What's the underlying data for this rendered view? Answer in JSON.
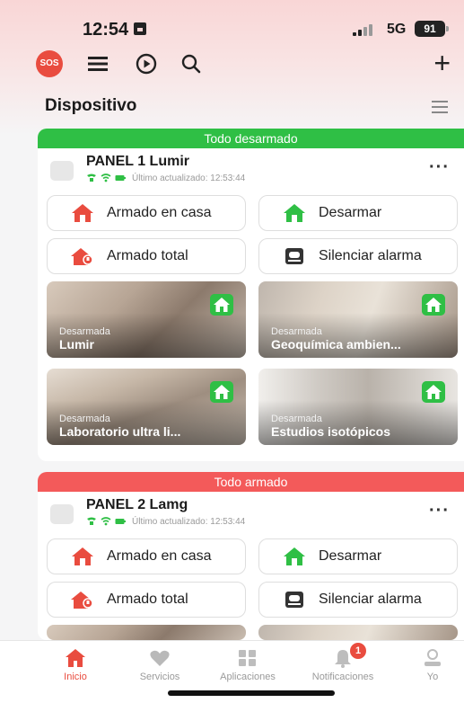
{
  "status_bar": {
    "time": "12:54",
    "network": "5G",
    "battery": "91"
  },
  "toolbar": {
    "sos_label": "SOS",
    "plus_label": "+"
  },
  "section": {
    "title": "Dispositivo"
  },
  "panels": [
    {
      "banner": "Todo desarmado",
      "banner_color": "#2fbf45",
      "name": "PANEL 1 Lumir",
      "updated": "Último actualizado: 12:53:44",
      "buttons": [
        "Armado en casa",
        "Desarmar",
        "Armado total",
        "Silenciar alarma"
      ],
      "zones": [
        {
          "state": "Desarmada",
          "name": "Lumir"
        },
        {
          "state": "Desarmada",
          "name": "Geoquímica ambien..."
        },
        {
          "state": "Desarmada",
          "name": "Laboratorio ultra li..."
        },
        {
          "state": "Desarmada",
          "name": "Estudios isotópicos"
        }
      ]
    },
    {
      "banner": "Todo armado",
      "banner_color": "#f35a5a",
      "name": "PANEL 2 Lamg",
      "updated": "Último actualizado: 12:53:44",
      "buttons": [
        "Armado en casa",
        "Desarmar",
        "Armado total",
        "Silenciar alarma"
      ]
    }
  ],
  "bottom_nav": {
    "items": [
      {
        "label": "Inicio",
        "icon": "home-icon",
        "active": true
      },
      {
        "label": "Servicios",
        "icon": "heart-icon"
      },
      {
        "label": "Aplicaciones",
        "icon": "apps-icon"
      },
      {
        "label": "Notificaciones",
        "icon": "bell-icon",
        "badge": "1"
      },
      {
        "label": "Yo",
        "icon": "person-icon"
      }
    ]
  },
  "colors": {
    "accent_red": "#e94c3f",
    "armed_green": "#2fbf45",
    "armed_red_banner": "#f35a5a"
  }
}
